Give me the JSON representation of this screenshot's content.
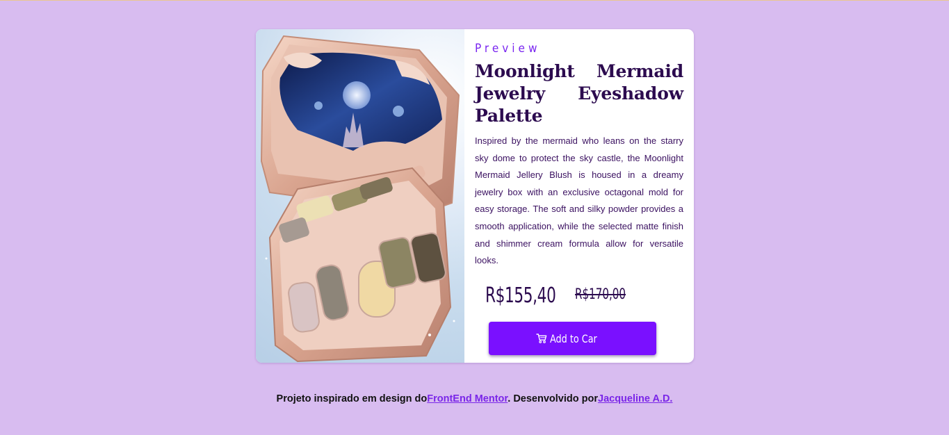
{
  "product": {
    "eyebrow": "Preview",
    "title": "Moonlight Mermaid Jewelry Eyeshadow Palette",
    "description": " Inspired by the mermaid who leans on the starry sky dome to protect the sky castle, the Moonlight Mermaid Jellery Blush is housed in a dreamy jewelry box with an exclusive octagonal mold for easy storage. The soft and silky powder provides a smooth application, while the selected matte finish and shimmer cream formula allow for versatile looks.",
    "price_current": "R$155,40",
    "price_old": "R$170,00",
    "button_label": "Add to Car",
    "button_icon": "cart-icon",
    "image_alt": "Moonlight Mermaid Jewelry Eyeshadow Palette"
  },
  "footer": {
    "text_before": "Projeto inspirado em design do",
    "link1_label": "FrontEnd Mentor",
    "text_middle": ". Desenvolvido por",
    "link2_label": "Jacqueline A.D."
  },
  "colors": {
    "page_background": "#d8bcf0",
    "accent": "#7a10ff",
    "title": "#2c0b4f",
    "link": "#7a26e8"
  }
}
